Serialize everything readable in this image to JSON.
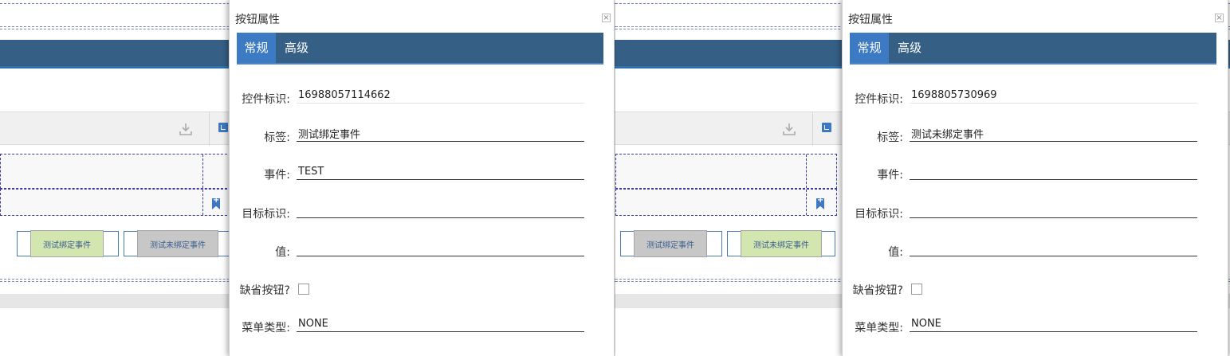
{
  "left": {
    "buttons": {
      "first": "测试绑定事件",
      "second": "测试未绑定事件"
    },
    "dialog": {
      "title": "按钮属性",
      "tabs": [
        "常规",
        "高级"
      ],
      "fields": {
        "id_label": "控件标识:",
        "id_value": "16988057114662",
        "label_label": "标签:",
        "label_value": "测试绑定事件",
        "event_label": "事件:",
        "event_value": "TEST",
        "target_label": "目标标识:",
        "target_value": "",
        "value_label": "值:",
        "value_value": "",
        "default_label": "缺省按钮?",
        "menu_label": "菜单类型:",
        "menu_value": "NONE"
      }
    }
  },
  "right": {
    "buttons": {
      "first": "测试绑定事件",
      "second": "测试未绑定事件"
    },
    "dialog": {
      "title": "按钮属性",
      "tabs": [
        "常规",
        "高级"
      ],
      "fields": {
        "id_label": "控件标识:",
        "id_value": "1698805730969",
        "label_label": "标签:",
        "label_value": "测试未绑定事件",
        "event_label": "事件:",
        "event_value": "",
        "target_label": "目标标识:",
        "target_value": "",
        "value_label": "值:",
        "value_value": "",
        "default_label": "缺省按钮?",
        "menu_label": "菜单类型:",
        "menu_value": "NONE"
      }
    }
  },
  "icons": [
    "download-icon",
    "resize-icon",
    "bookmark-add-icon",
    "close-icon"
  ],
  "colors": {
    "header_blue": "#355f84",
    "active_tab": "#3c7bc4",
    "event_bound": "#d4e6b0",
    "event_unbound": "#c7c7c7"
  }
}
